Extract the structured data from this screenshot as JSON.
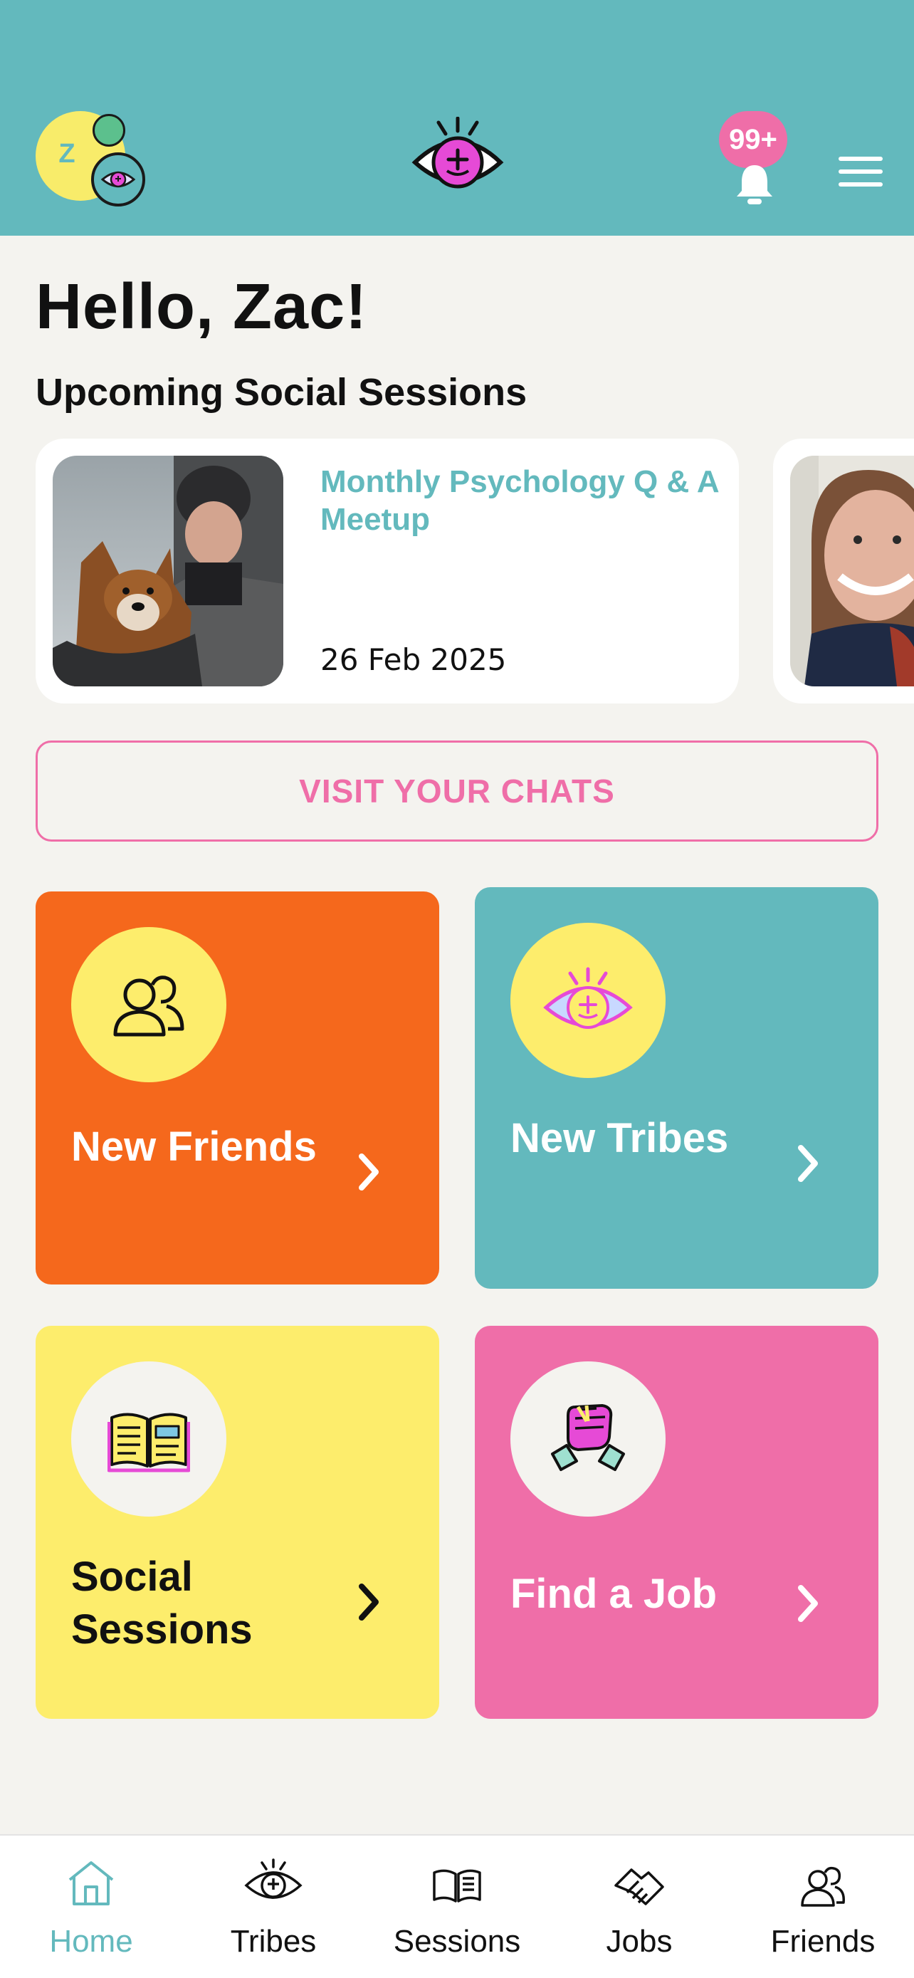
{
  "header": {
    "avatar_initial": "Z",
    "notification_count": "99+",
    "colors": {
      "bar": "#63b9bd",
      "badge": "#ef6ea8"
    }
  },
  "greeting": "Hello, Zac!",
  "upcoming": {
    "heading": "Upcoming Social Sessions",
    "sessions": [
      {
        "title": "Monthly Psychology Q & A Meetup",
        "date": "26 Feb 2025"
      }
    ]
  },
  "chats_button": "VISIT YOUR CHATS",
  "tiles": [
    {
      "label": "New Friends",
      "icon": "people-icon",
      "color": "#f5681c"
    },
    {
      "label": "New Tribes",
      "icon": "eye-icon",
      "color": "#63b9bd"
    },
    {
      "label": "Social Sessions",
      "icon": "book-icon",
      "color": "#fded6c"
    },
    {
      "label": "Find a Job",
      "icon": "handshake-icon",
      "color": "#ef6ea8"
    }
  ],
  "tabbar": {
    "items": [
      {
        "label": "Home",
        "icon": "home-icon",
        "active": true
      },
      {
        "label": "Tribes",
        "icon": "eye-icon"
      },
      {
        "label": "Sessions",
        "icon": "book-icon"
      },
      {
        "label": "Jobs",
        "icon": "handshake-icon"
      },
      {
        "label": "Friends",
        "icon": "people-icon"
      }
    ]
  }
}
